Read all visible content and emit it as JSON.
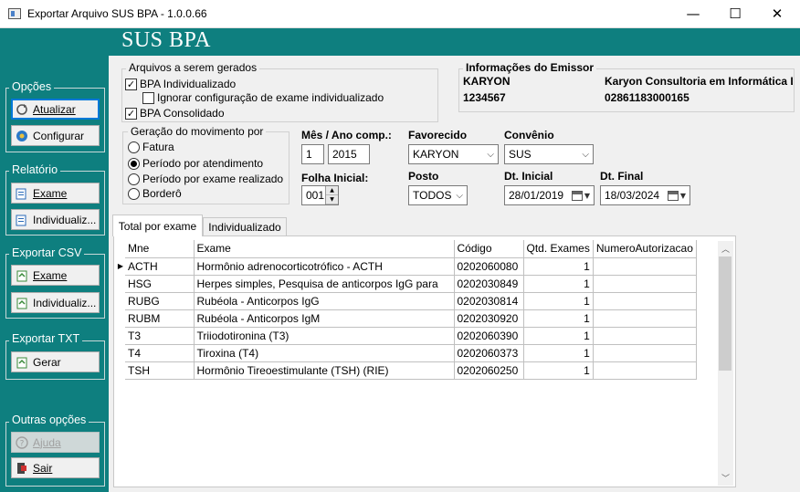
{
  "window": {
    "title": "Exportar Arquivo SUS BPA  - 1.0.0.66",
    "minimize": "—",
    "maximize": "☐",
    "close": "✕"
  },
  "header": {
    "title": "SUS BPA"
  },
  "sidebar": {
    "opcoes": {
      "label": "Opções",
      "atualizar": "Atualizar",
      "configurar": "Configurar"
    },
    "relatorio": {
      "label": "Relatório",
      "exame": "Exame",
      "individualizado": "Individualiz..."
    },
    "exportar_csv": {
      "label": "Exportar CSV",
      "exame": "Exame",
      "individualizado": "Individualiz..."
    },
    "exportar_txt": {
      "label": "Exportar TXT",
      "gerar": "Gerar"
    },
    "outras": {
      "label": "Outras opções",
      "ajuda": "Ajuda",
      "sair": "Sair"
    }
  },
  "arquivos": {
    "label": "Arquivos a serem gerados",
    "bpa_individualizado": {
      "label": "BPA Individualizado",
      "checked": true
    },
    "ignorar": {
      "label": "Ignorar configuração de exame individualizado",
      "checked": false
    },
    "bpa_consolidado": {
      "label": "BPA Consolidado",
      "checked": true
    }
  },
  "emissor": {
    "label": "Informações do Emissor",
    "nome_curto": "KARYON",
    "codigo": "1234567",
    "razao_social": "Karyon Consultoria em Informática Lt",
    "cnpj": "02861183000165"
  },
  "geracao": {
    "label": "Geração do movimento por",
    "options": [
      {
        "label": "Fatura",
        "selected": false
      },
      {
        "label": "Período por atendimento",
        "selected": true
      },
      {
        "label": "Período por exame realizado",
        "selected": false
      },
      {
        "label": "Borderô",
        "selected": false
      }
    ]
  },
  "form": {
    "mes_ano_label": "Mês / Ano comp.:",
    "mes": "1",
    "ano": "2015",
    "folha_label": "Folha Inicial:",
    "folha": "001",
    "favorecido_label": "Favorecido",
    "favorecido": "KARYON",
    "convenio_label": "Convênio",
    "convenio": "SUS",
    "posto_label": "Posto",
    "posto": "TODOS",
    "dt_inicial_label": "Dt. Inicial",
    "dt_inicial": "28/01/2019",
    "dt_final_label": "Dt. Final",
    "dt_final": "18/03/2024"
  },
  "tabs": {
    "total": "Total por exame",
    "individualizado": "Individualizado"
  },
  "grid": {
    "headers": [
      "Mne",
      "Exame",
      "Código",
      "Qtd. Exames",
      "NumeroAutorizacao"
    ],
    "current_row_marker": "▶",
    "rows": [
      [
        "ACTH",
        "Hormônio adrenocorticotrófico - ACTH",
        "0202060080",
        "1",
        ""
      ],
      [
        "HSG",
        "Herpes simples, Pesquisa de anticorpos IgG para",
        "0202030849",
        "1",
        ""
      ],
      [
        "RUBG",
        "Rubéola - Anticorpos IgG",
        "0202030814",
        "1",
        ""
      ],
      [
        "RUBM",
        "Rubéola - Anticorpos IgM",
        "0202030920",
        "1",
        ""
      ],
      [
        "T3",
        "Triiodotironina (T3)",
        "0202060390",
        "1",
        ""
      ],
      [
        "T4",
        "Tiroxina (T4)",
        "0202060373",
        "1",
        ""
      ],
      [
        "TSH",
        "Hormônio Tireoestimulante (TSH) (RIE)",
        "0202060250",
        "1",
        ""
      ]
    ]
  },
  "colors": {
    "teal": "#0e7f7f",
    "panel": "#f0f0f0"
  }
}
